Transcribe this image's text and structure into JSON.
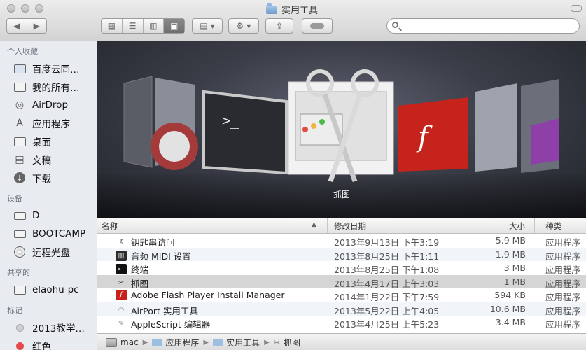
{
  "window": {
    "title": "实用工具"
  },
  "toolbar": {
    "back_icon": "chevron-left",
    "forward_icon": "chevron-right",
    "search_placeholder": ""
  },
  "sidebar": {
    "sections": [
      {
        "title": "个人收藏",
        "items": [
          {
            "label": "百度云同…",
            "icon": "folder-icon"
          },
          {
            "label": "我的所有…",
            "icon": "all-files-icon"
          },
          {
            "label": "AirDrop",
            "icon": "airdrop-icon"
          },
          {
            "label": "应用程序",
            "icon": "applications-icon"
          },
          {
            "label": "桌面",
            "icon": "desktop-icon"
          },
          {
            "label": "文稿",
            "icon": "documents-icon"
          },
          {
            "label": "下载",
            "icon": "downloads-icon"
          }
        ]
      },
      {
        "title": "设备",
        "items": [
          {
            "label": "D",
            "icon": "drive-icon"
          },
          {
            "label": "BOOTCAMP",
            "icon": "drive-icon"
          },
          {
            "label": "远程光盘",
            "icon": "disc-icon"
          }
        ]
      },
      {
        "title": "共享的",
        "items": [
          {
            "label": "elaohu-pc",
            "icon": "computer-icon"
          }
        ]
      },
      {
        "title": "标记",
        "items": [
          {
            "label": "2013教学…",
            "icon": "tag-gray-icon"
          },
          {
            "label": "红色",
            "icon": "tag-red-icon"
          }
        ]
      }
    ]
  },
  "coverflow": {
    "caption": "抓图"
  },
  "list": {
    "columns": {
      "name": "名称",
      "date": "修改日期",
      "size": "大小",
      "kind": "种类"
    },
    "rows": [
      {
        "name": "钥匙串访问",
        "date": "2013年9月13日 下午3:19",
        "size": "5.9 MB",
        "kind": "应用程序",
        "icon": "keychain-icon",
        "color": "#8a8a8a"
      },
      {
        "name": "音频 MIDI 设置",
        "date": "2013年8月25日 下午1:11",
        "size": "1.9 MB",
        "kind": "应用程序",
        "icon": "midi-icon",
        "color": "#2b2b2b"
      },
      {
        "name": "终端",
        "date": "2013年8月25日 下午1:08",
        "size": "3 MB",
        "kind": "应用程序",
        "icon": "terminal-icon",
        "color": "#111111"
      },
      {
        "name": "抓图",
        "date": "2013年4月17日 上午3:03",
        "size": "1 MB",
        "kind": "应用程序",
        "icon": "grab-icon",
        "color": "#7a7a7a"
      },
      {
        "name": "Adobe Flash Player Install Manager",
        "date": "2014年1月22日 下午7:59",
        "size": "594 KB",
        "kind": "应用程序",
        "icon": "flash-icon",
        "color": "#c8201c"
      },
      {
        "name": "AirPort 实用工具",
        "date": "2013年5月22日 上午4:05",
        "size": "10.6 MB",
        "kind": "应用程序",
        "icon": "airport-icon",
        "color": "#9a9a9a"
      },
      {
        "name": "AppleScript 编辑器",
        "date": "2013年4月25日 上午5:23",
        "size": "3.4 MB",
        "kind": "应用程序",
        "icon": "applescript-icon",
        "color": "#b0b0b0"
      }
    ]
  },
  "pathbar": {
    "items": [
      {
        "label": "mac",
        "icon": "hard-disk-icon"
      },
      {
        "label": "应用程序",
        "icon": "folder-icon"
      },
      {
        "label": "实用工具",
        "icon": "folder-icon"
      },
      {
        "label": "抓图",
        "icon": "grab-icon"
      }
    ]
  }
}
